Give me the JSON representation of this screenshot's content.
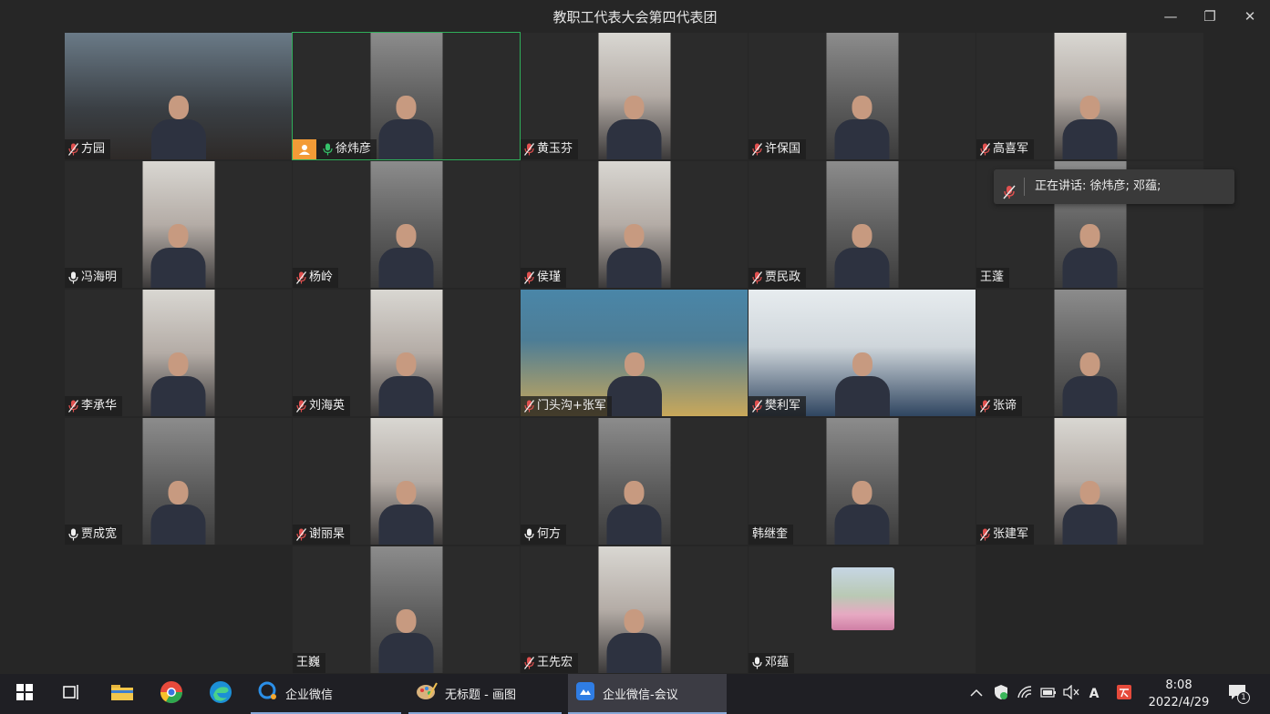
{
  "window": {
    "title": "教职工代表大会第四代表团",
    "minimize": "—",
    "restore": "❐",
    "close": "✕"
  },
  "participants": [
    {
      "name": "方园",
      "mic": "muted"
    },
    {
      "name": "徐炜彦",
      "mic": "on",
      "active": true
    },
    {
      "name": "黄玉芬",
      "mic": "muted"
    },
    {
      "name": "许保国",
      "mic": "muted"
    },
    {
      "name": "高喜军",
      "mic": "muted"
    },
    {
      "name": "冯海明",
      "mic": "on"
    },
    {
      "name": "杨岭",
      "mic": "muted"
    },
    {
      "name": "侯瑾",
      "mic": "muted"
    },
    {
      "name": "贾民政",
      "mic": "muted"
    },
    {
      "name": "王蓬",
      "mic": "none"
    },
    {
      "name": "李承华",
      "mic": "muted"
    },
    {
      "name": "刘海英",
      "mic": "muted"
    },
    {
      "name": "门头沟+张军",
      "mic": "muted"
    },
    {
      "name": "樊利军",
      "mic": "muted"
    },
    {
      "name": "张谛",
      "mic": "muted"
    },
    {
      "name": "贾成宽",
      "mic": "on"
    },
    {
      "name": "谢丽杲",
      "mic": "muted"
    },
    {
      "name": "何方",
      "mic": "on"
    },
    {
      "name": "韩继奎",
      "mic": "none"
    },
    {
      "name": "张建军",
      "mic": "muted"
    },
    {
      "name": "王巍",
      "mic": "none"
    },
    {
      "name": "王先宏",
      "mic": "muted"
    },
    {
      "name": "邓蕴",
      "mic": "on"
    }
  ],
  "speaking_tooltip": {
    "text": "正在讲话: 徐炜彦; 邓蕴;"
  },
  "taskbar": {
    "apps": [
      {
        "label": "企业微信"
      },
      {
        "label": "无标题 - 画图"
      },
      {
        "label": "企业微信-会议"
      }
    ],
    "time": "8:08",
    "date": "2022/4/29",
    "notification_count": "1",
    "ime_label": "A"
  },
  "colors": {
    "active_border": "#2fae5a",
    "muted_mic": "#e0504f",
    "active_mic": "#35c26a",
    "avatar_badge": "#f39b36",
    "taskbar_accent": "#86a7d6"
  }
}
